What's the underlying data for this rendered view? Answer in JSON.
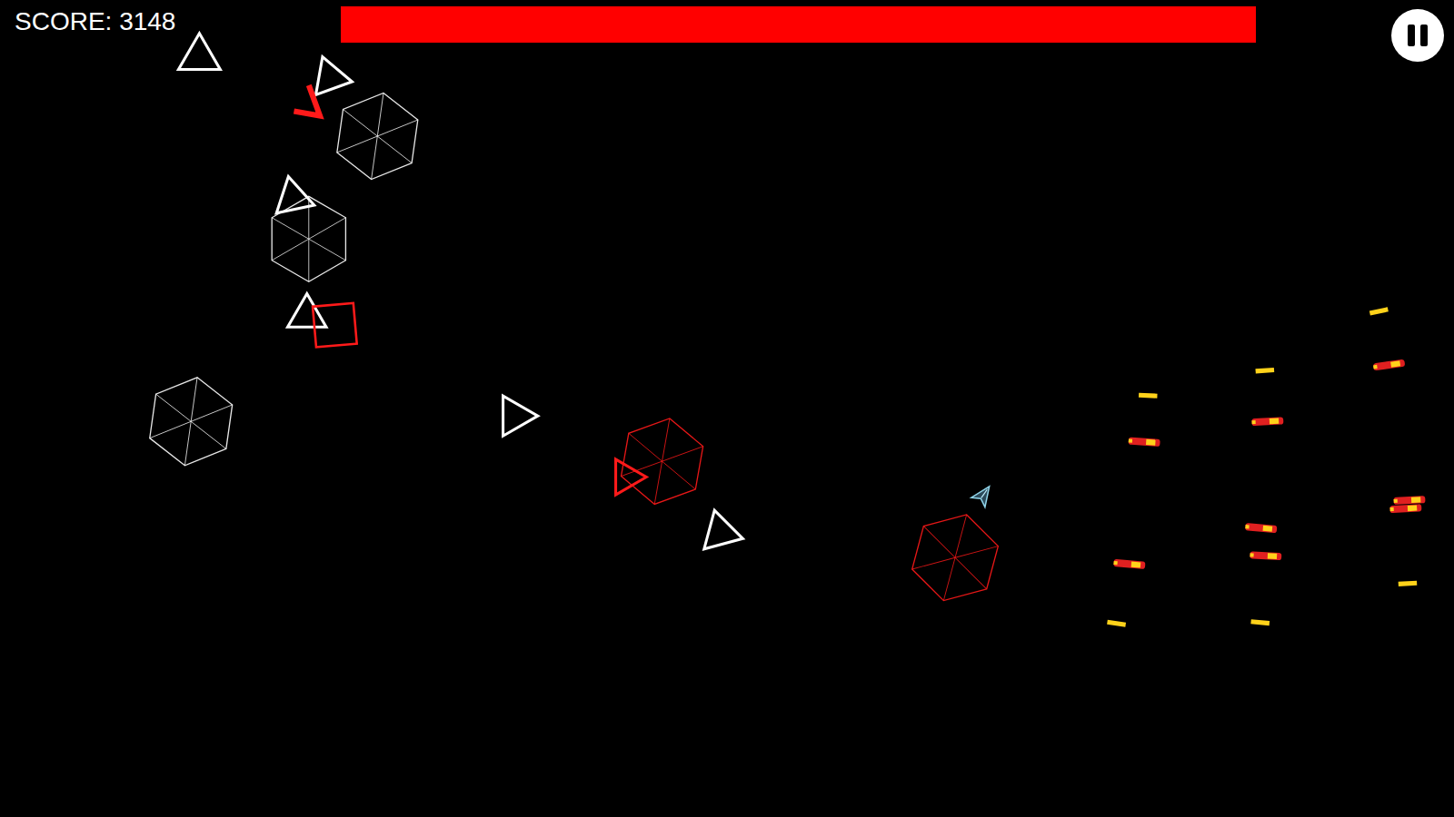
{
  "score": {
    "text": "SCORE: 3148"
  },
  "health_bar": {
    "level": 1.0
  },
  "enemies": [
    {
      "kind": "triangle",
      "color": "#ffffff"
    },
    {
      "kind": "triangle",
      "color": "#ffffff"
    },
    {
      "kind": "chevron",
      "color": "#ff1a1a"
    },
    {
      "kind": "hexagon",
      "color": "#ffffff"
    },
    {
      "kind": "triangle",
      "color": "#ffffff"
    },
    {
      "kind": "hexagon",
      "color": "#ffffff"
    },
    {
      "kind": "triangle",
      "color": "#ffffff"
    },
    {
      "kind": "square",
      "color": "#ff1a1a"
    },
    {
      "kind": "hexagon",
      "color": "#ffffff"
    },
    {
      "kind": "triangle",
      "color": "#ffffff"
    },
    {
      "kind": "hexagon",
      "color": "#ff1a1a"
    },
    {
      "kind": "triangle",
      "color": "#ff1a1a"
    },
    {
      "kind": "triangle",
      "color": "#ffffff"
    },
    {
      "kind": "hexagon",
      "color": "#ff1a1a"
    }
  ],
  "projectiles": [
    {
      "kind": "shot"
    },
    {
      "kind": "shot"
    },
    {
      "kind": "shot"
    },
    {
      "kind": "shot"
    },
    {
      "kind": "shot"
    },
    {
      "kind": "shot"
    },
    {
      "kind": "missile"
    },
    {
      "kind": "missile"
    },
    {
      "kind": "missile"
    },
    {
      "kind": "missile"
    },
    {
      "kind": "missile"
    },
    {
      "kind": "missile"
    },
    {
      "kind": "missile"
    },
    {
      "kind": "missile"
    }
  ]
}
